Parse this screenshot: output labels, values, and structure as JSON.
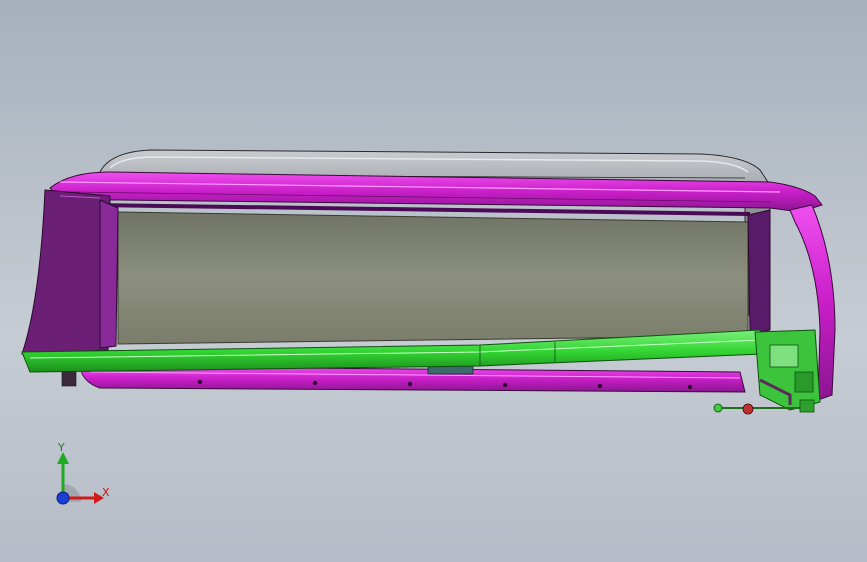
{
  "viewport": {
    "background_top": "#a7b0bc",
    "background_bottom": "#c6ccd3"
  },
  "model": {
    "colors": {
      "frame_magenta": "#d21fd2",
      "frame_dark_purple": "#5e1b6b",
      "glass_panel": "#7f8372",
      "gray_seal": "#8a8d93",
      "green_rail": "#35e035",
      "green_mechanism": "#41c841"
    }
  },
  "triad": {
    "y_label": "Y",
    "x_label": "X",
    "colors": {
      "y_axis": "#1faa1f",
      "x_axis": "#d21a1a",
      "z_axis": "#1a3fd2"
    }
  }
}
